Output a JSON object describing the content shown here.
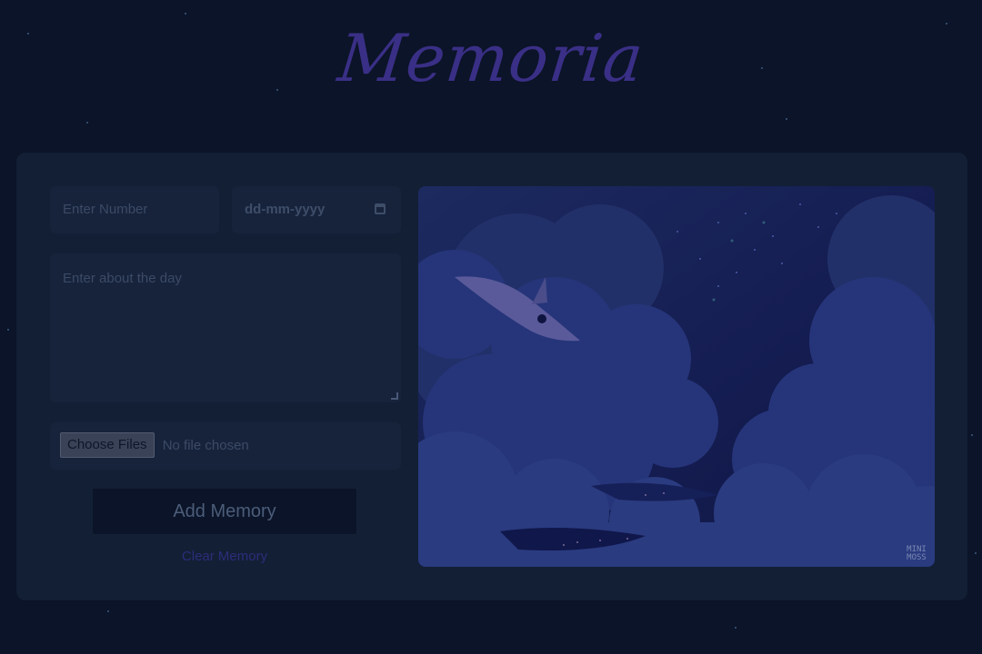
{
  "app": {
    "title": "Memoria"
  },
  "form": {
    "number_placeholder": "Enter Number",
    "date_placeholder": "dd-mm-yyyy",
    "text_placeholder": "Enter about the day",
    "file_button_label": "Choose Files",
    "file_status": "No file chosen",
    "add_button_label": "Add Memory",
    "clear_link_label": "Clear Memory"
  },
  "illustration": {
    "watermark": "MINI MOSS"
  },
  "colors": {
    "background": "#0b1428",
    "panel": "#131f35",
    "title": "#3a2f86",
    "accent_link": "#2b2d7a"
  }
}
